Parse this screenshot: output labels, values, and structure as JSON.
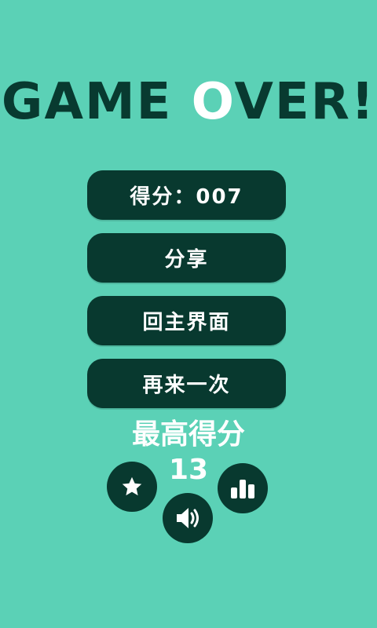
{
  "title": {
    "prefix": "GAME ",
    "highlight": "O",
    "suffix": "VER!"
  },
  "menu": {
    "score_label": "得分：007",
    "share_label": "分享",
    "home_label": "回主界面",
    "retry_label": "再来一次"
  },
  "best": {
    "label": "最高得分",
    "value": "13"
  },
  "icons": {
    "rate": "star-icon",
    "leaderboard": "bar-chart-icon",
    "sound": "speaker-icon"
  },
  "colors": {
    "background": "#5bd1b6",
    "button": "#08392f",
    "title": "#083a30",
    "text": "#ffffff"
  }
}
